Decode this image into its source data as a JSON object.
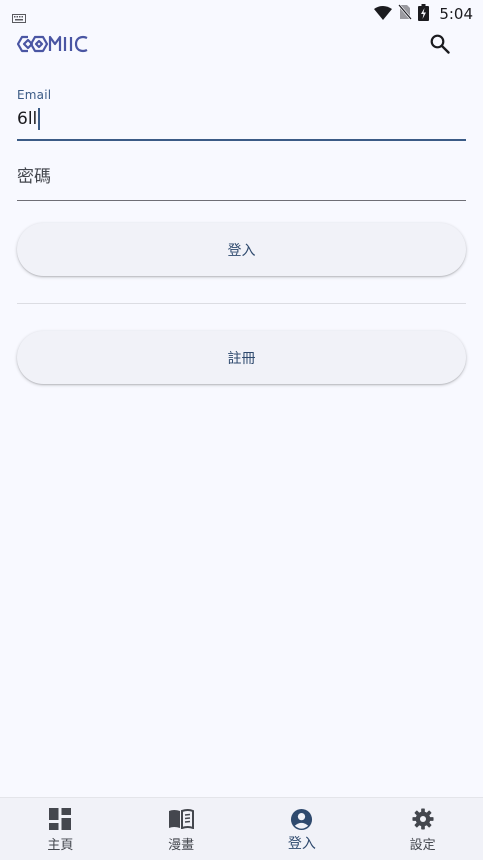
{
  "status_bar": {
    "time": "5:04",
    "icons": [
      "keyboard-icon",
      "wifi-icon",
      "no-sim-icon",
      "battery-charging-icon"
    ]
  },
  "app_bar": {
    "logo_text": "COMIIC",
    "search_icon": "search-icon"
  },
  "login_form": {
    "email_label": "Email",
    "email_value": "6ll",
    "password_placeholder": "密碼",
    "login_button_label": "登入",
    "register_button_label": "註冊"
  },
  "bottom_nav": {
    "items": [
      {
        "label": "主頁",
        "icon": "dashboard-icon",
        "active": false
      },
      {
        "label": "漫畫",
        "icon": "book-icon",
        "active": false
      },
      {
        "label": "登入",
        "icon": "account-circle-icon",
        "active": true
      },
      {
        "label": "設定",
        "icon": "gear-icon",
        "active": false
      }
    ]
  },
  "colors": {
    "background": "#f8f9ff",
    "accent": "#3b5b86",
    "button_text": "#2f4a6e",
    "logo": "#4a56a3"
  }
}
